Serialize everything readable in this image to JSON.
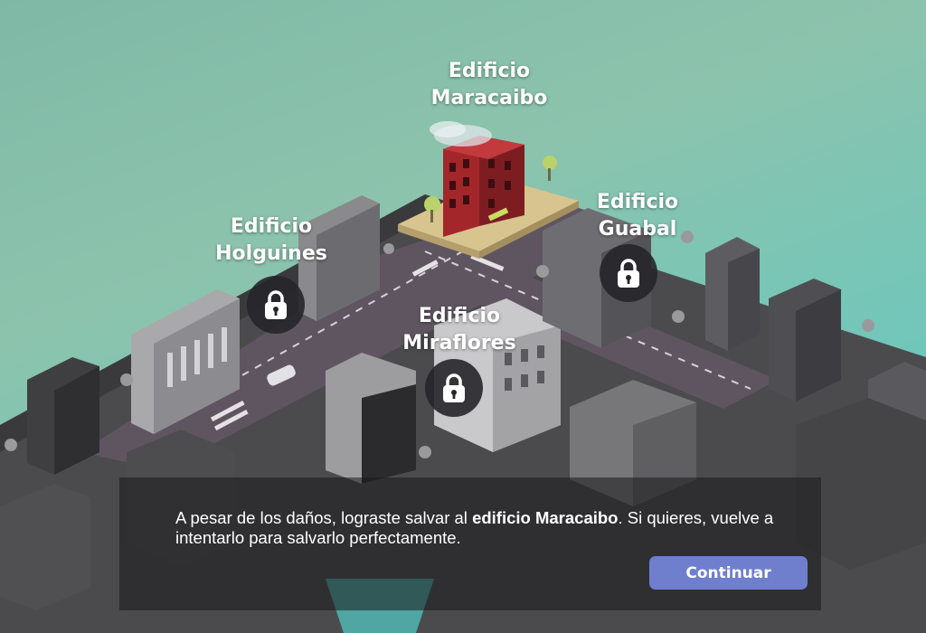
{
  "colors": {
    "sky": "#6dc7bc",
    "road": "#5f5560",
    "highlight_building": "#a3262a",
    "lot": "#d8c48e",
    "button": "#6f7fcd",
    "panel": "rgba(25,25,28,0.55)"
  },
  "buildings": [
    {
      "id": "maracaibo",
      "name_line1": "Edificio",
      "name_line2": "Maracaibo",
      "locked": false
    },
    {
      "id": "holguines",
      "name_line1": "Edificio",
      "name_line2": "Holguines",
      "locked": true,
      "icon": "lock-icon"
    },
    {
      "id": "guabal",
      "name_line1": "Edificio",
      "name_line2": "Guabal",
      "locked": true,
      "icon": "lock-icon"
    },
    {
      "id": "miraflores",
      "name_line1": "Edificio",
      "name_line2": "Miraflores",
      "locked": true,
      "icon": "lock-icon"
    }
  ],
  "message": {
    "part1": "A pesar de los daños, lograste  salvar al ",
    "bold": "edificio Maracaibo",
    "part2": ". Si quieres, vuelve a intentarlo para salvarlo perfectamente."
  },
  "continue_label": "Continuar"
}
